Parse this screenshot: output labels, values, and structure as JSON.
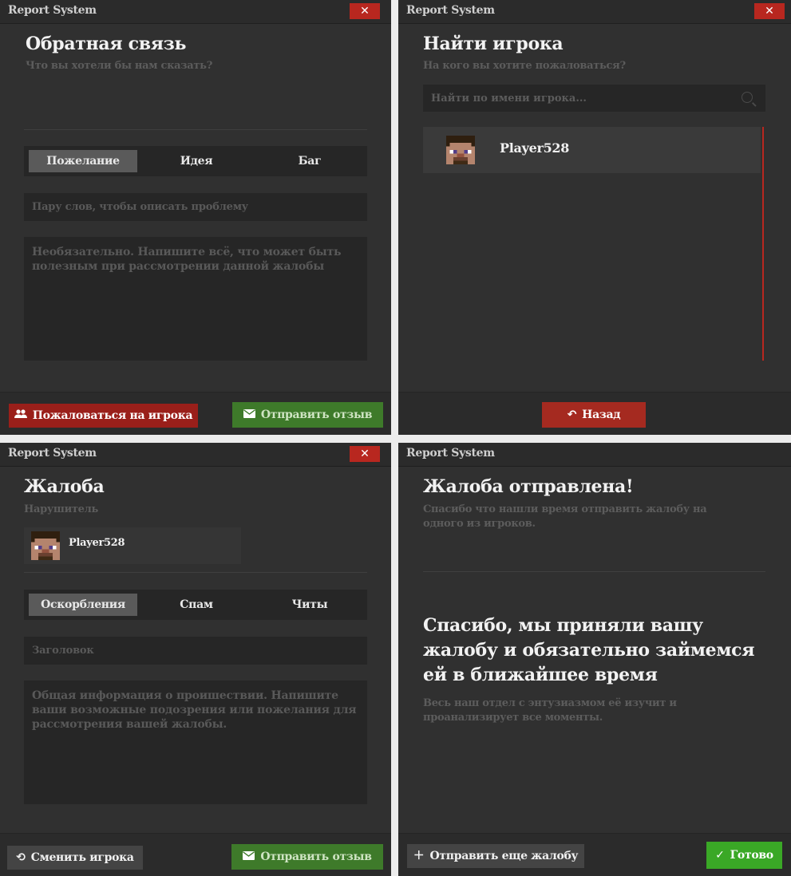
{
  "app_title": "Report System",
  "close_label": "✕",
  "feedback": {
    "title": "Обратная связь",
    "subtitle": "Что вы хотели бы нам сказать?",
    "tabs": [
      "Пожелание",
      "Идея",
      "Баг"
    ],
    "summary_placeholder": "Пару слов, чтобы описать проблему",
    "details_placeholder": "Необязательно. Напишите всё, что может быть полезным при рассмотрении данной жалобы",
    "report_player_label": "Пожаловаться на игрока",
    "send_label": "Отправить отзыв"
  },
  "find_player": {
    "title": "Найти игрока",
    "subtitle": "На кого вы хотите пожаловаться?",
    "search_placeholder": "Найти по имени игрока...",
    "players": [
      "Player528"
    ],
    "back_label": "Назад"
  },
  "complaint": {
    "title": "Жалоба",
    "offender_label": "Нарушитель",
    "offender_name": "Player528",
    "tabs": [
      "Оскорбления",
      "Спам",
      "Читы"
    ],
    "title_placeholder": "Заголовок",
    "details_placeholder": "Общая информация о проишествии. Напишите ваши возможные подозрения или пожелания для рассмотрения вашей жалобы.",
    "change_player_label": "Сменить игрока",
    "send_label": "Отправить отзыв"
  },
  "sent": {
    "title": "Жалоба отправлена!",
    "subtitle": "Спасибо что нашли время отправить жалобу на одного из игроков.",
    "message": "Спасибо, мы приняли вашу жалобу и обязательно займемся ей в ближайшее время",
    "note": "Весь наш отдел с энтузиазмом её изучит и проанализирует все моменты.",
    "send_another_label": "Отправить еще жалобу",
    "done_label": "Готово"
  },
  "colors": {
    "window_bg": "#303030",
    "close_red": "#b8271f",
    "send_green": "#3e7a2a",
    "done_green": "#3aa826",
    "report_red": "#9a1f1a"
  }
}
